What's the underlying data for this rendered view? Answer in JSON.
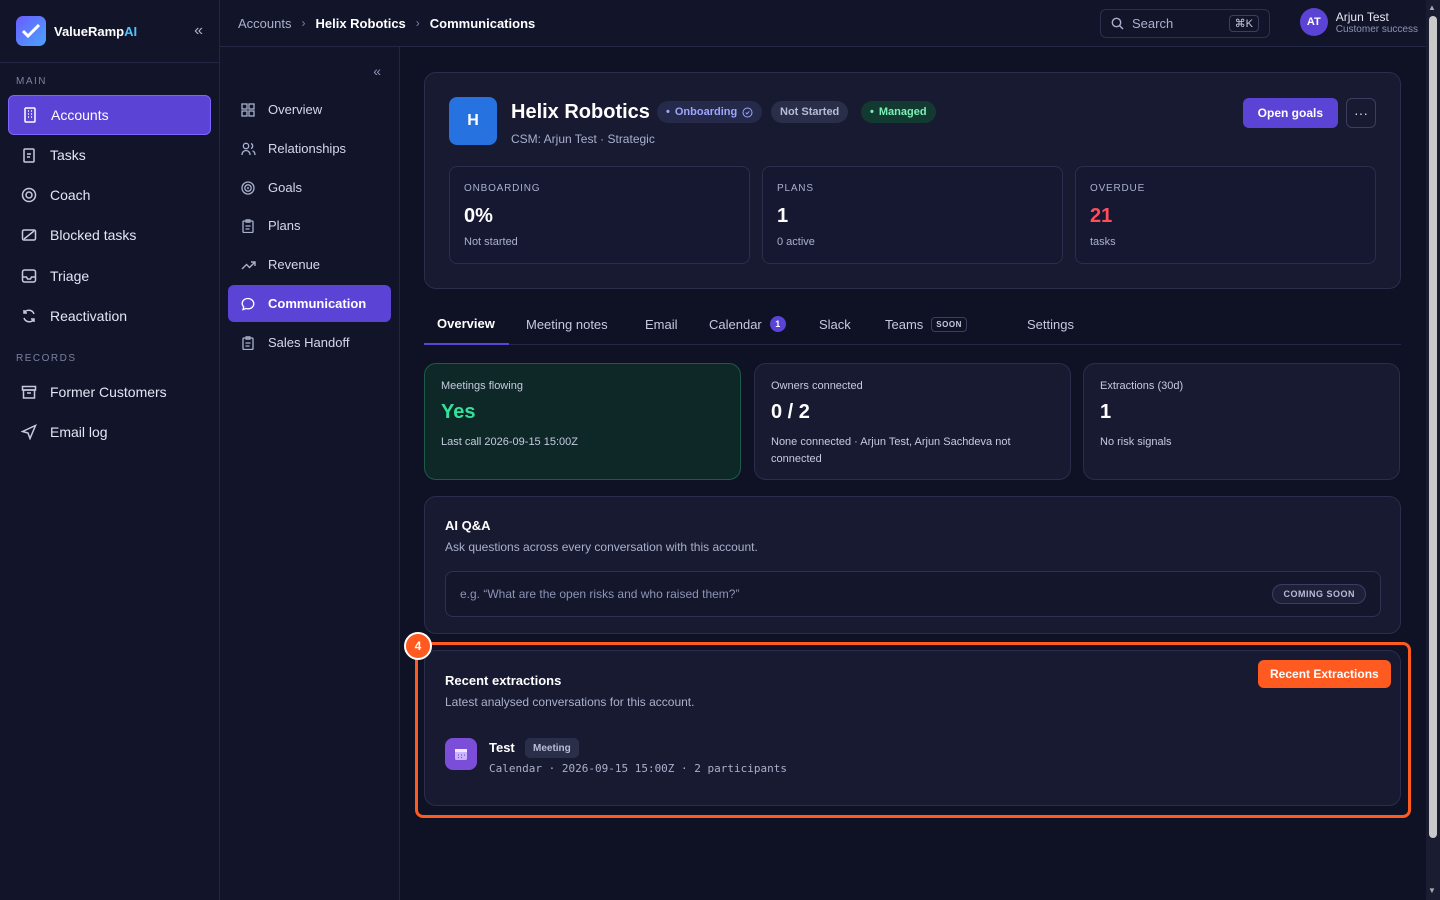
{
  "app": {
    "brand_main": "ValueRamp",
    "brand_accent": "AI"
  },
  "sidebar": {
    "section_main": "MAIN",
    "section_records": "RECORDS",
    "items": [
      {
        "label": "Accounts",
        "icon": "building-icon"
      },
      {
        "label": "Tasks",
        "icon": "clipboard-icon"
      },
      {
        "label": "Coach",
        "icon": "target-icon"
      },
      {
        "label": "Blocked tasks",
        "icon": "blocked-icon"
      },
      {
        "label": "Triage",
        "icon": "inbox-icon"
      },
      {
        "label": "Reactivation",
        "icon": "refresh-icon"
      }
    ],
    "records": [
      {
        "label": "Former Customers",
        "icon": "archive-icon"
      },
      {
        "label": "Email log",
        "icon": "send-icon"
      }
    ]
  },
  "subnav": {
    "items": [
      {
        "label": "Overview",
        "icon": "grid-icon"
      },
      {
        "label": "Relationships",
        "icon": "users-icon"
      },
      {
        "label": "Goals",
        "icon": "target-icon"
      },
      {
        "label": "Plans",
        "icon": "clipboard-icon"
      },
      {
        "label": "Revenue",
        "icon": "trend-up-icon"
      },
      {
        "label": "Communication",
        "icon": "chat-icon"
      },
      {
        "label": "Sales Handoff",
        "icon": "clipboard-icon"
      }
    ]
  },
  "breadcrumb": [
    "Accounts",
    "Helix Robotics",
    "Communications"
  ],
  "search": {
    "label": "Search",
    "shortcut": "⌘K"
  },
  "user": {
    "initials": "AT",
    "name": "Arjun Test",
    "role": "Customer success"
  },
  "account": {
    "initial": "H",
    "name": "Helix Robotics",
    "subtitle": "CSM: Arjun Test · Strategic",
    "badges": {
      "onboarding": "Onboarding",
      "status": "Not Started",
      "managed": "Managed"
    },
    "open_goals": "Open goals",
    "more": "···"
  },
  "stats": [
    {
      "label": "ONBOARDING",
      "value": "0%",
      "note": "Not started"
    },
    {
      "label": "PLANS",
      "value": "1",
      "note": "0 active"
    },
    {
      "label": "OVERDUE",
      "value": "21",
      "note": "tasks"
    }
  ],
  "tabs": {
    "overview": "Overview",
    "meeting_notes": "Meeting notes",
    "email": "Email",
    "calendar": "Calendar",
    "calendar_count": "1",
    "slack": "Slack",
    "teams": "Teams",
    "teams_tag": "SOON",
    "settings": "Settings"
  },
  "metrics": [
    {
      "label": "Meetings flowing",
      "value": "Yes",
      "note": "Last call 2026-09-15 15:00Z"
    },
    {
      "label": "Owners connected",
      "value": "0 / 2",
      "note": "None connected · Arjun Test, Arjun Sachdeva not connected"
    },
    {
      "label": "Extractions (30d)",
      "value": "1",
      "note": "No risk signals"
    }
  ],
  "qa": {
    "title": "AI Q&A",
    "subtitle": "Ask questions across every conversation with this account.",
    "placeholder": "e.g. “What are the open risks and who raised them?”",
    "soon": "COMING SOON"
  },
  "recent": {
    "step": "4",
    "button": "Recent Extractions",
    "title": "Recent extractions",
    "subtitle": "Latest analysed conversations for this account.",
    "items": [
      {
        "title": "Test",
        "type": "Meeting",
        "meta": "Calendar · 2026-09-15 15:00Z · 2 participants"
      }
    ]
  },
  "colors": {
    "accent": "#5b43d6",
    "highlight": "#ff5a1f",
    "success": "#32e29a",
    "danger": "#ff4d5a"
  }
}
